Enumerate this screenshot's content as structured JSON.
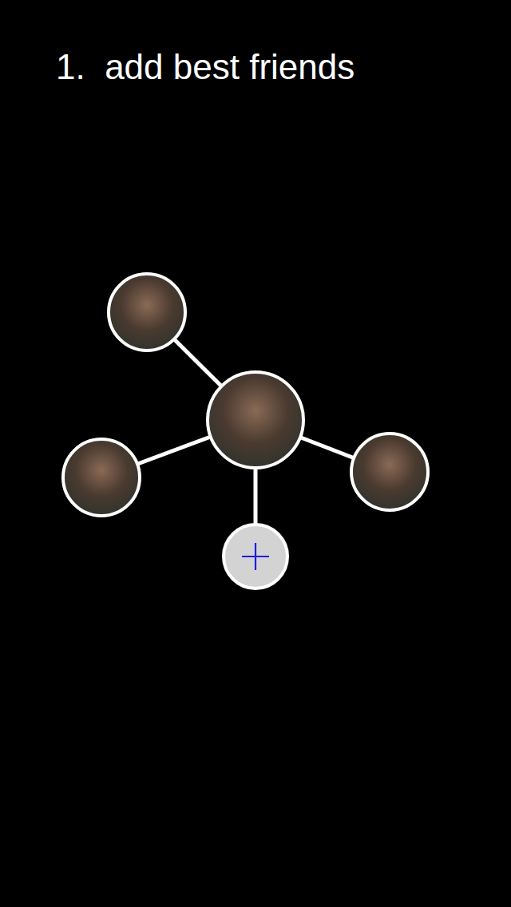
{
  "title": "1.  add best friends",
  "graph": {
    "me": {
      "kind": "photo"
    },
    "friends": [
      {
        "kind": "photo"
      },
      {
        "kind": "photo"
      },
      {
        "kind": "photo"
      },
      {
        "kind": "add"
      }
    ]
  }
}
